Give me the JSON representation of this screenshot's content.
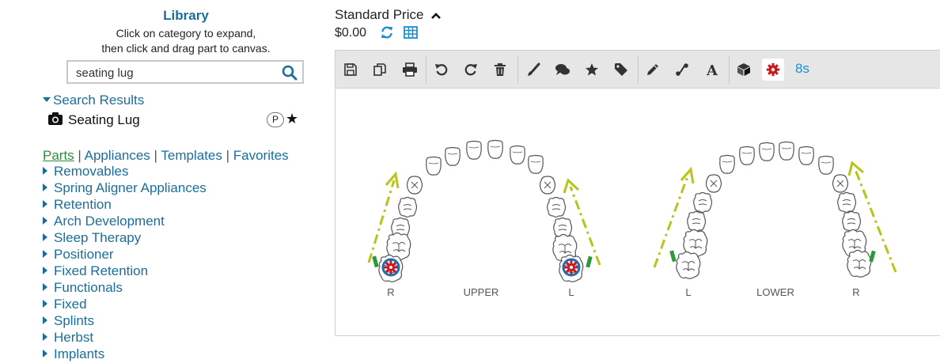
{
  "library": {
    "title": "Library",
    "instructions_line1": "Click on category to expand,",
    "instructions_line2": "then click and drag part to canvas.",
    "search": {
      "value": "seating lug",
      "icon": "search-icon"
    },
    "search_results": {
      "heading": "Search Results",
      "items": [
        {
          "label": "Seating Lug",
          "badge": "P",
          "icon": "camera-icon",
          "favorite": true
        }
      ]
    },
    "category_links": {
      "parts": "Parts",
      "appliances": "Appliances",
      "templates": "Templates",
      "favorites": "Favorites",
      "separator": "|"
    },
    "tree": [
      "Removables",
      "Spring Aligner Appliances",
      "Retention",
      "Arch Development",
      "Sleep Therapy",
      "Positioner",
      "Fixed Retention",
      "Functionals",
      "Fixed",
      "Splints",
      "Herbst",
      "Implants"
    ]
  },
  "pricing": {
    "label": "Standard Price",
    "value": "$0.00"
  },
  "toolbar": {
    "tools": [
      "save",
      "copy",
      "print",
      "undo",
      "redo",
      "delete",
      "brush",
      "comments",
      "star",
      "tag",
      "pencil",
      "connector",
      "text",
      "3d-box",
      "settings"
    ],
    "timer": "8s"
  },
  "canvas": {
    "upper_label": "UPPER",
    "lower_label": "LOWER",
    "upper_right": "R",
    "upper_left": "L",
    "lower_left": "L",
    "lower_right": "R",
    "colors": {
      "arrow": "#b9c41a",
      "lug": "#2a9a3a",
      "ring": "#1f6fb0",
      "gear": "#c8191e",
      "tooth": "#555555"
    }
  }
}
